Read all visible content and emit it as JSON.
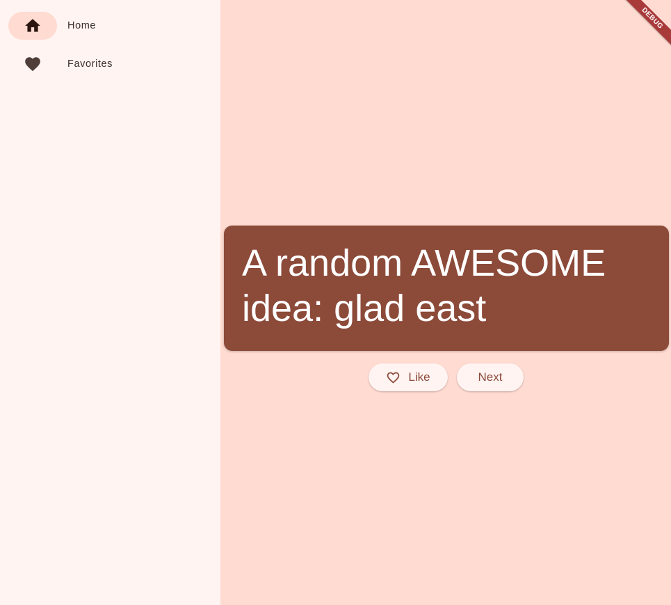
{
  "navigation": {
    "items": [
      {
        "label": "Home",
        "icon": "home-icon",
        "selected": true
      },
      {
        "label": "Favorites",
        "icon": "heart-icon",
        "selected": false
      }
    ]
  },
  "main": {
    "idea_text": "A random AWESOME idea: glad east",
    "buttons": {
      "like_label": "Like",
      "next_label": "Next"
    }
  },
  "debug_banner": "DEBUG",
  "colors": {
    "rail_background": "#fff4f2",
    "main_background": "#ffdbd1",
    "card": "#8c4a39",
    "selected_indicator": "#ffdbd1",
    "debug_banner": "#a83a3a"
  }
}
